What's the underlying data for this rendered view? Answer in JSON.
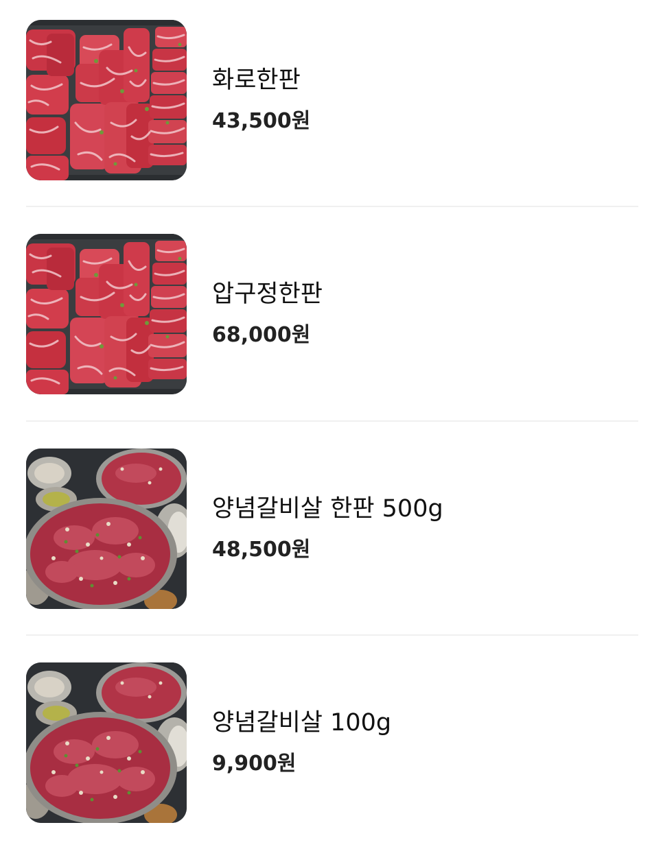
{
  "menu": {
    "items": [
      {
        "name": "화로한판",
        "price": "43,500원",
        "image": "marbled-beef-slate-photo"
      },
      {
        "name": "압구정한판",
        "price": "68,000원",
        "image": "marbled-beef-slate-photo"
      },
      {
        "name": "양념갈비살 한판 500g",
        "price": "48,500원",
        "image": "marinated-rib-platter-photo"
      },
      {
        "name": "양념갈비살 100g",
        "price": "9,900원",
        "image": "marinated-rib-platter-photo"
      }
    ]
  }
}
